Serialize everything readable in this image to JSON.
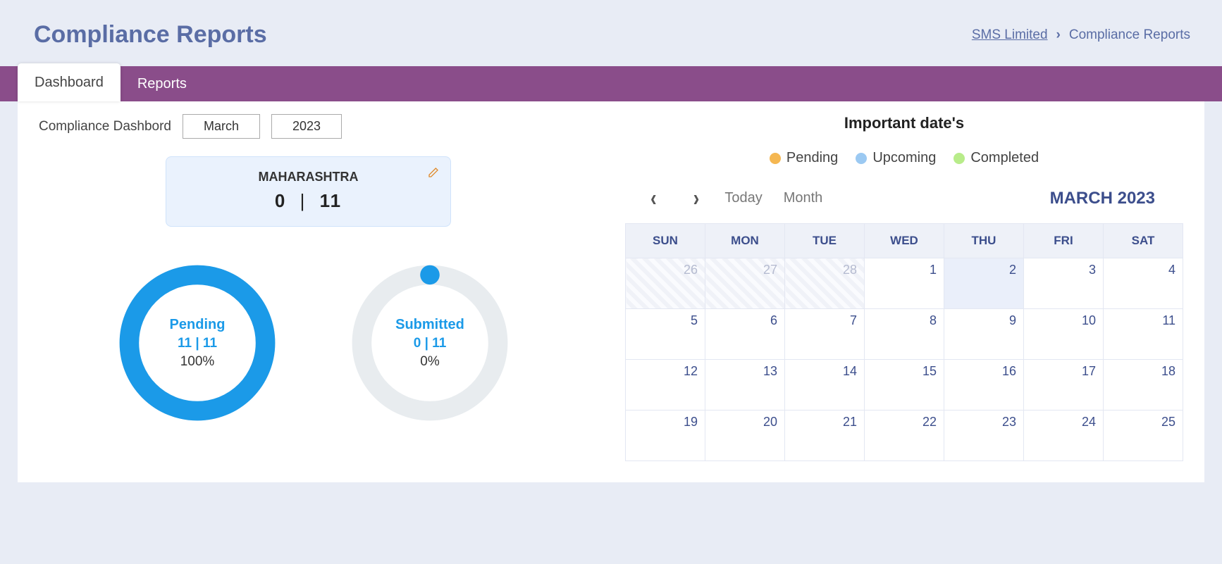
{
  "header": {
    "title": "Compliance Reports",
    "breadcrumb": {
      "root": "SMS Limited",
      "current": "Compliance Reports"
    }
  },
  "tabs": {
    "dashboard": "Dashboard",
    "reports": "Reports"
  },
  "filter": {
    "label": "Compliance Dashbord",
    "month": "March",
    "year": "2023"
  },
  "state_card": {
    "name": "MAHARASHTRA",
    "count_left": "0",
    "count_right": "11"
  },
  "rings": {
    "pending": {
      "title": "Pending",
      "counts": "11 | 11",
      "percent": "100%",
      "value": 100
    },
    "submitted": {
      "title": "Submitted",
      "counts": "0 | 11",
      "percent": "0%",
      "value": 0
    }
  },
  "calendar": {
    "section_title": "Important date's",
    "legend": {
      "pending": "Pending",
      "upcoming": "Upcoming",
      "completed": "Completed"
    },
    "colors": {
      "pending": "#f5b751",
      "upcoming": "#9bc9f2",
      "completed": "#b8ec8a"
    },
    "today_btn": "Today",
    "month_btn": "Month",
    "title": "MARCH 2023",
    "day_headers": [
      "SUN",
      "MON",
      "TUE",
      "WED",
      "THU",
      "FRI",
      "SAT"
    ],
    "weeks": [
      [
        {
          "d": "26",
          "other": true
        },
        {
          "d": "27",
          "other": true
        },
        {
          "d": "28",
          "other": true
        },
        {
          "d": "1"
        },
        {
          "d": "2",
          "today": true
        },
        {
          "d": "3"
        },
        {
          "d": "4"
        }
      ],
      [
        {
          "d": "5"
        },
        {
          "d": "6"
        },
        {
          "d": "7"
        },
        {
          "d": "8"
        },
        {
          "d": "9"
        },
        {
          "d": "10"
        },
        {
          "d": "11"
        }
      ],
      [
        {
          "d": "12"
        },
        {
          "d": "13"
        },
        {
          "d": "14"
        },
        {
          "d": "15"
        },
        {
          "d": "16"
        },
        {
          "d": "17"
        },
        {
          "d": "18"
        }
      ],
      [
        {
          "d": "19"
        },
        {
          "d": "20"
        },
        {
          "d": "21"
        },
        {
          "d": "22"
        },
        {
          "d": "23"
        },
        {
          "d": "24"
        },
        {
          "d": "25"
        }
      ]
    ]
  }
}
